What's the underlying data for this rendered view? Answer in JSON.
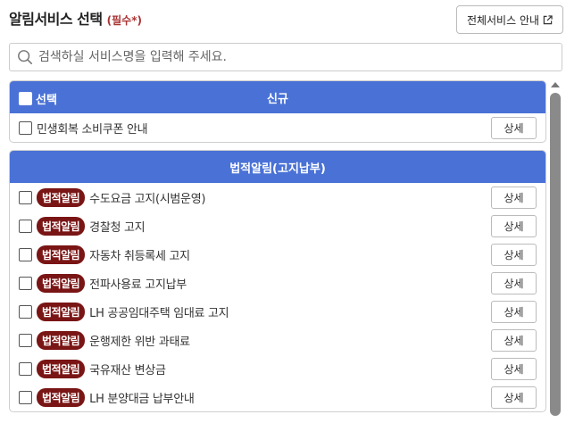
{
  "header": {
    "title": "알림서비스 선택",
    "required": "(필수*)",
    "all_services_button": "전체서비스 안내",
    "all_services_icon": "external-link-icon"
  },
  "search": {
    "placeholder": "검색하실 서비스명을 입력해 주세요.",
    "value": "",
    "icon": "search-icon"
  },
  "section_new": {
    "select_label": "선택",
    "title": "신규",
    "items": [
      {
        "label": "민생회복 소비쿠폰 안내",
        "detail": "상세"
      }
    ]
  },
  "section_legal": {
    "title": "법적알림(고지납부)",
    "badge": "법적알림",
    "items": [
      {
        "label": "수도요금 고지(시범운영)",
        "detail": "상세"
      },
      {
        "label": "경찰청 고지",
        "detail": "상세"
      },
      {
        "label": "자동차 취등록세 고지",
        "detail": "상세"
      },
      {
        "label": "전파사용료 고지납부",
        "detail": "상세"
      },
      {
        "label": "LH 공공임대주택 임대료 고지",
        "detail": "상세"
      },
      {
        "label": "운행제한 위반 과태료",
        "detail": "상세"
      },
      {
        "label": "국유재산 변상금",
        "detail": "상세"
      },
      {
        "label": "LH 분양대금 납부안내",
        "detail": "상세"
      }
    ]
  },
  "colors": {
    "header_blue": "#4a72d6",
    "badge_red": "#7a1515"
  }
}
